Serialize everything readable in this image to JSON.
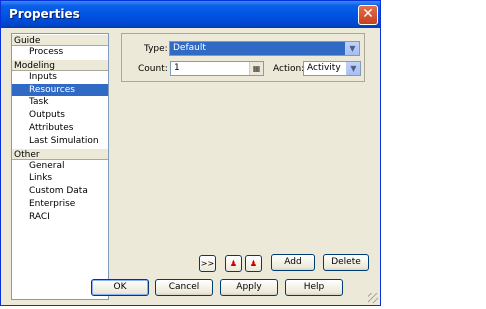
{
  "window": {
    "title": "Properties"
  },
  "nav": {
    "groups": [
      {
        "label": "Guide",
        "items": [
          {
            "label": "Process"
          }
        ]
      },
      {
        "label": "Modeling",
        "items": [
          {
            "label": "Inputs"
          },
          {
            "label": "Resources",
            "selected": true
          },
          {
            "label": "Task"
          },
          {
            "label": "Outputs"
          },
          {
            "label": "Attributes"
          },
          {
            "label": "Last Simulation"
          }
        ]
      },
      {
        "label": "Other",
        "items": [
          {
            "label": "General"
          },
          {
            "label": "Links"
          },
          {
            "label": "Custom Data"
          },
          {
            "label": "Enterprise"
          },
          {
            "label": "RACI"
          }
        ]
      }
    ]
  },
  "form": {
    "type_label": "Type:",
    "type_value": "Default",
    "count_label": "Count:",
    "count_value": "1",
    "action_label": "Action:",
    "action_value": "Activity"
  },
  "toolbar": {
    "more_label": ">>",
    "add_label": "Add",
    "delete_label": "Delete"
  },
  "footer": {
    "ok": "OK",
    "cancel": "Cancel",
    "apply": "Apply",
    "help": "Help"
  },
  "colors": {
    "selection": "#316ac5",
    "dialog_bg": "#ece9d8",
    "titlebar": "#0054e3"
  }
}
